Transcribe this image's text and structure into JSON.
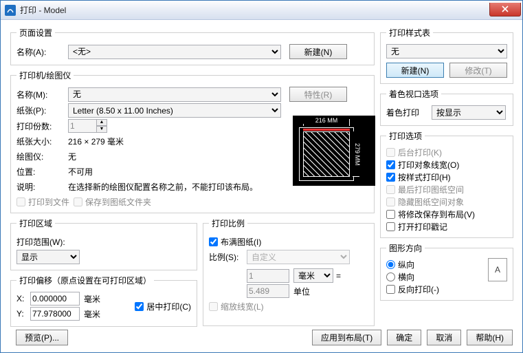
{
  "window": {
    "title": "打印 - Model"
  },
  "page_setup": {
    "legend": "页面设置",
    "name_label": "名称(A):",
    "name_value": "<无>",
    "new_btn": "新建(N)"
  },
  "printer": {
    "legend": "打印机/绘图仪",
    "name_label": "名称(M):",
    "name_value": "无",
    "props_btn": "特性(R)",
    "paper_label": "纸张(P):",
    "paper_value": "Letter (8.50 x 11.00 Inches)",
    "copies_label": "打印份数:",
    "copies_value": "1",
    "size_label": "纸张大小:",
    "size_value": "216 × 279  毫米",
    "plotter_label": "绘图仪:",
    "plotter_value": "无",
    "location_label": "位置:",
    "location_value": "不可用",
    "desc_label": "说明:",
    "desc_value": "在选择新的绘图仪配置名称之前，不能打印该布局。",
    "print_to_file": "打印到文件",
    "save_to_sheet": "保存到图纸文件夹",
    "preview": {
      "width_dim": "216 MM",
      "height_dim": "279 MM"
    }
  },
  "area": {
    "legend": "打印区域",
    "range_label": "打印范围(W):",
    "range_value": "显示"
  },
  "offset": {
    "legend": "打印偏移（原点设置在可打印区域）",
    "x_label": "X:",
    "x_value": "0.000000",
    "x_unit": "毫米",
    "y_label": "Y:",
    "y_value": "77.978000",
    "y_unit": "毫米",
    "center": "居中打印(C)"
  },
  "scale": {
    "legend": "打印比例",
    "fit": "布满图纸(I)",
    "ratio_label": "比例(S):",
    "ratio_value": "自定义",
    "units_top": "1",
    "units_select": "毫米",
    "eq": "=",
    "units_bottom": "5.489",
    "units_label": "单位",
    "scale_lw": "缩放线宽(L)"
  },
  "style_table": {
    "legend": "打印样式表",
    "value": "无",
    "new_btn": "新建(N)",
    "edit_btn": "修改(T)"
  },
  "shade": {
    "legend": "着色视口选项",
    "label": "着色打印",
    "value": "按显示"
  },
  "options": {
    "legend": "打印选项",
    "bg": "后台打印(K)",
    "lw": "打印对象线宽(O)",
    "bystyle": "按样式打印(H)",
    "last_paper": "最后打印图纸空间",
    "hide_paper": "隐藏图纸空间对象",
    "save_layout": "将修改保存到布局(V)",
    "open_stamp": "打开打印戳记"
  },
  "orient": {
    "legend": "图形方向",
    "portrait": "纵向",
    "landscape": "横向",
    "upside": "反向打印(-)",
    "glyph": "A"
  },
  "footer": {
    "preview": "预览(P)...",
    "apply_layout": "应用到布局(T)",
    "ok": "确定",
    "cancel": "取消",
    "help": "帮助(H)"
  }
}
